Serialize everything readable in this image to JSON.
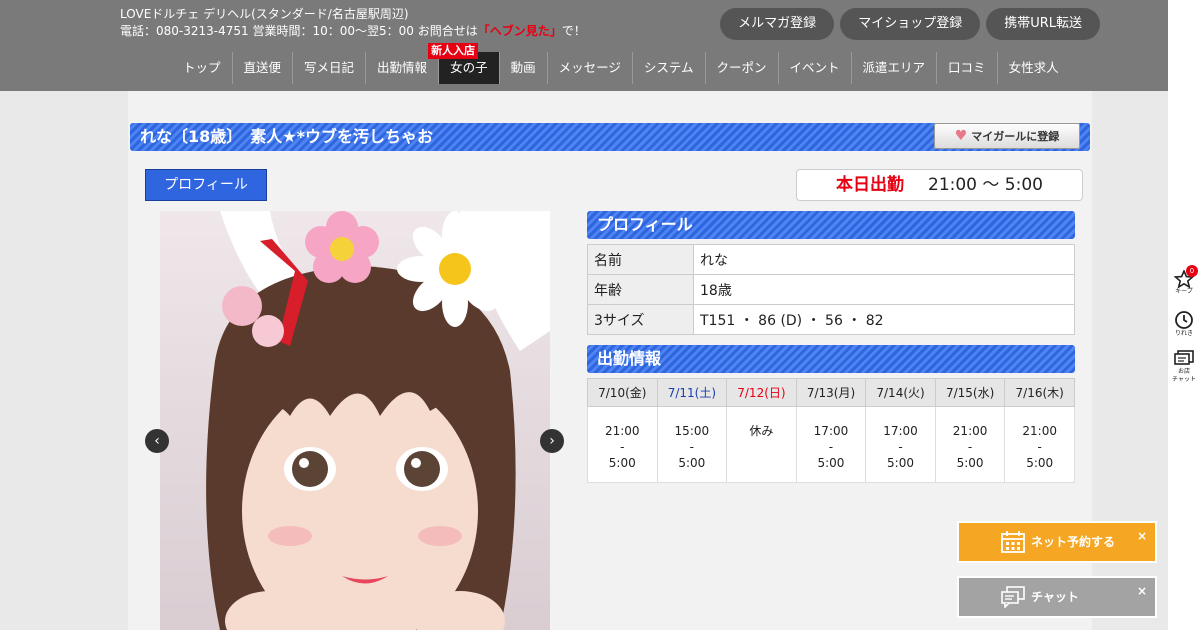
{
  "header": {
    "shop_name": "LOVEドルチェ デリヘル(スタンダード/名古屋駅周辺)",
    "contact_prefix": "電話：080-3213-4751 営業時間：10：00～翌5：00 お問合せは",
    "contact_highlight": "「ヘブン見た」",
    "contact_suffix": "で！",
    "buttons": [
      "メルマガ登録",
      "マイショップ登録",
      "携帯URL転送"
    ]
  },
  "nav": {
    "items": [
      "トップ",
      "直送便",
      "写メ日記",
      "出勤情報",
      "女の子",
      "動画",
      "メッセージ",
      "システム",
      "クーポン",
      "イベント",
      "派遣エリア",
      "口コミ",
      "女性求人"
    ],
    "badge": "新人入店"
  },
  "side": {
    "keep_label": "キープ",
    "keep_count": "0",
    "history_label": "りれき",
    "chat_label1": "お店",
    "chat_label2": "チャット"
  },
  "girl": {
    "title": "れな〔18歳〕　素人★*ウブを汚しちゃお",
    "mygirl_label": "マイガールに登録",
    "profile_tab": "プロフィール",
    "today_label": "本日出勤",
    "today_time": "21:00 ～ 5:00"
  },
  "profile": {
    "heading": "プロフィール",
    "rows": [
      {
        "key": "名前",
        "value": "れな"
      },
      {
        "key": "年齢",
        "value": "18歳"
      },
      {
        "key": "3サイズ",
        "value": "T151 ・ 86 (D) ・ 56 ・ 82"
      }
    ]
  },
  "schedule": {
    "heading": "出勤情報",
    "days": [
      {
        "date": "7/10(金)",
        "start": "21:00",
        "sep": "-",
        "end": "5:00"
      },
      {
        "date": "7/11(土)",
        "start": "15:00",
        "sep": "-",
        "end": "5:00"
      },
      {
        "date": "7/12(日)",
        "start": "休み",
        "sep": "",
        "end": ""
      },
      {
        "date": "7/13(月)",
        "start": "17:00",
        "sep": "-",
        "end": "5:00"
      },
      {
        "date": "7/14(火)",
        "start": "17:00",
        "sep": "-",
        "end": "5:00"
      },
      {
        "date": "7/15(水)",
        "start": "21:00",
        "sep": "-",
        "end": "5:00"
      },
      {
        "date": "7/16(木)",
        "start": "21:00",
        "sep": "-",
        "end": "5:00"
      }
    ]
  },
  "floating": {
    "reserve_label": "ネット予約する",
    "chat_label": "チャット",
    "close": "×"
  },
  "colors": {
    "accent_blue": "#2f66e0",
    "header_gray": "#7a7a7a",
    "alert_red": "#e60012",
    "reserve_orange": "#f5a623"
  }
}
